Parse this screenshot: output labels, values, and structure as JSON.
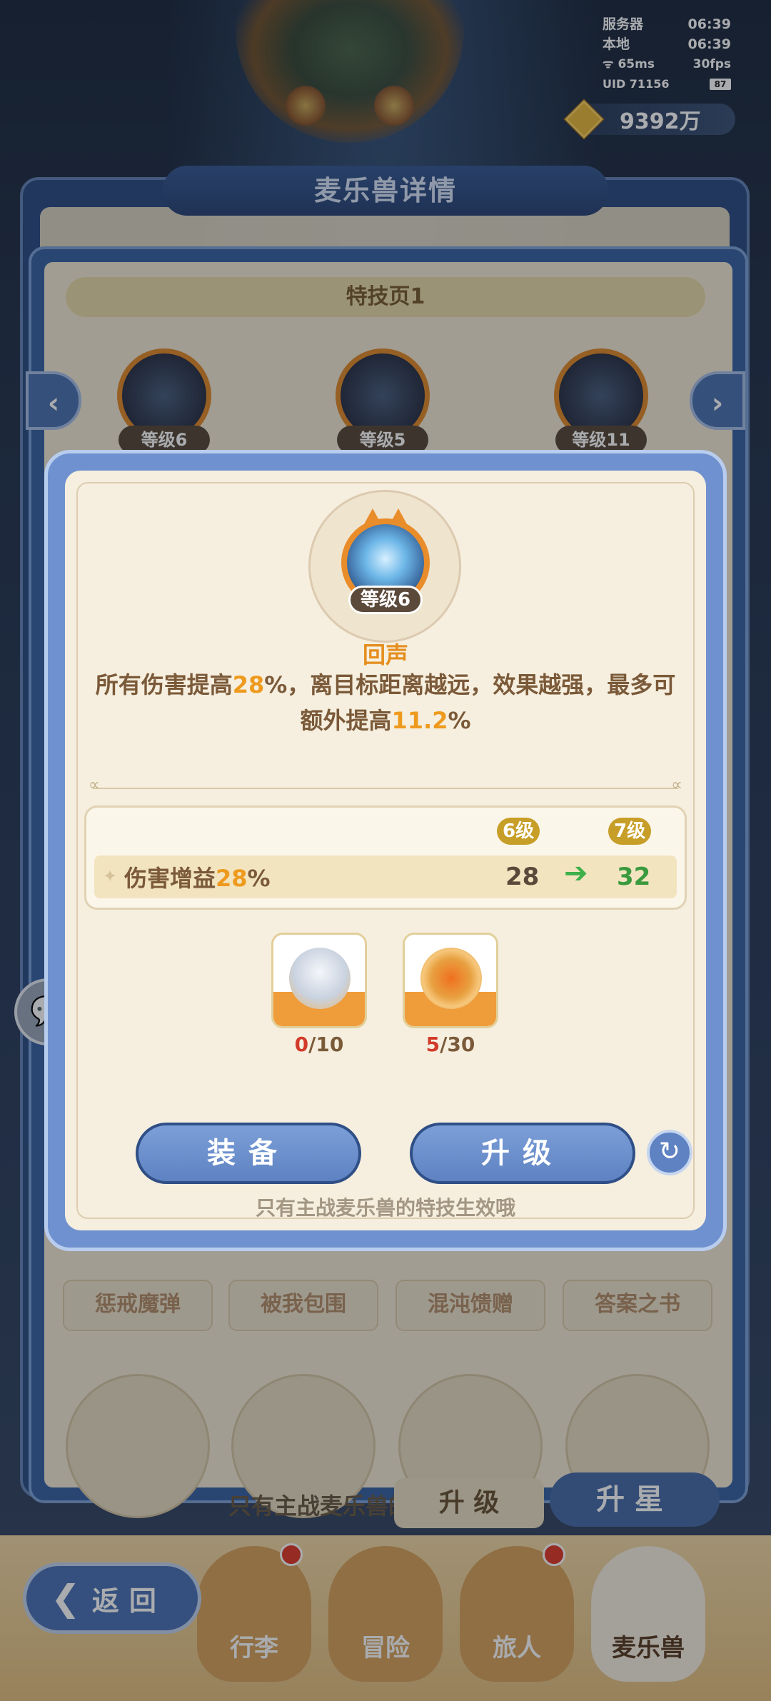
{
  "hud": {
    "server_label": "服务器",
    "server_time": "06:39",
    "local_label": "本地",
    "local_time": "06:39",
    "ping": "65ms",
    "fps": "30fps",
    "uid": "UID 71156",
    "battery": "87"
  },
  "currency": {
    "amount": "9392万",
    "icon": "gold-coin-icon"
  },
  "background_panel": {
    "title": "麦乐兽详情",
    "page_label": "特技页1",
    "skills": [
      {
        "level": "等级6"
      },
      {
        "level": "等级5"
      },
      {
        "level": "等级11"
      }
    ],
    "skill_names": [
      "惩戒魔弹",
      "被我包围",
      "混沌馈赠",
      "答案之书"
    ],
    "hint": "只有主战麦乐兽的特技生效哦",
    "upgrade_label": "升 级",
    "star_label": "升星"
  },
  "bottom_nav": {
    "back_label": "返回",
    "items": [
      {
        "label": "行李",
        "badge": true
      },
      {
        "label": "冒险",
        "badge": false
      },
      {
        "label": "旅人",
        "badge": true
      },
      {
        "label": "麦乐兽",
        "badge": false
      }
    ]
  },
  "popup": {
    "level_tag": "等级6",
    "skill_name": "回声",
    "desc_line1_a": "所有伤害提高",
    "desc_line1_hl": "28",
    "desc_line1_b": "%，离目标距离越远，效果越强，最多可",
    "desc_line2_a": "额外提高",
    "desc_line2_hl": "11.2",
    "desc_line2_b": "%",
    "cur_level_badge": "6级",
    "next_level_badge": "7级",
    "stat_label": "伤害增益",
    "stat_label_hl": "28",
    "stat_label_tail": "%",
    "stat_current": "28",
    "stat_next": "32",
    "materials": [
      {
        "have": "0",
        "need": "/10",
        "icon": "beast-fragment-icon"
      },
      {
        "have": "5",
        "need": "/30",
        "icon": "skill-medal-icon"
      }
    ],
    "equip_label": "装备",
    "upgrade_label": "升级",
    "hint": "只有主战麦乐兽的特技生效哦"
  }
}
